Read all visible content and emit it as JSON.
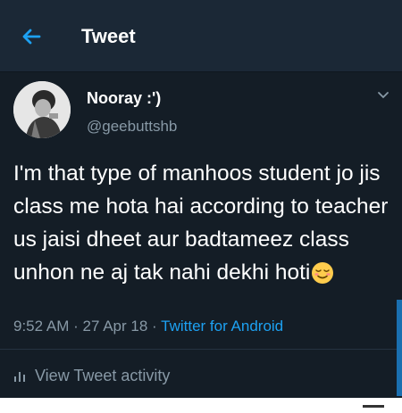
{
  "header": {
    "title": "Tweet"
  },
  "tweet": {
    "author_name": "Nooray :')",
    "author_handle": "@geebuttshb",
    "text": "I'm that type of manhoos student jo jis class me hota hai according to teacher us jaisi dheet aur badtameez class unhon ne aj tak nahi dekhi hoti",
    "time": "9:52 AM",
    "separator": "·",
    "date": "27 Apr 18",
    "source": "Twitter for Android"
  },
  "footer": {
    "activity_label": "View Tweet activity"
  },
  "icons": {
    "back": "arrow-left-icon",
    "menu": "chevron-down-icon",
    "emoji": "relieved-face-emoji",
    "activity": "bar-chart-icon"
  },
  "colors": {
    "background": "#141d26",
    "header_bg": "#1b2836",
    "accent": "#1da1f2",
    "muted": "#8899a6"
  }
}
